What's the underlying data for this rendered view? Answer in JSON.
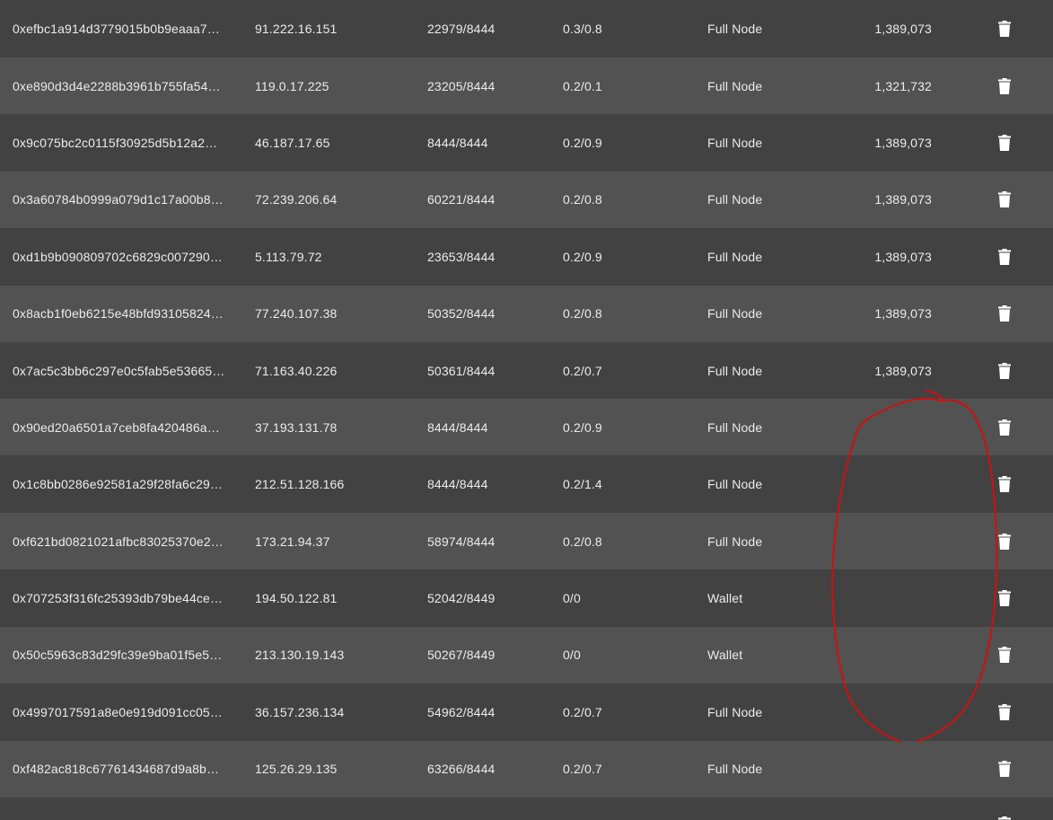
{
  "connections": {
    "rows": [
      {
        "node_id": "0xefbc1a914d3779015b0b9eaaa7…",
        "ip": "91.222.16.151",
        "ports": "22979/8444",
        "up_down": "0.3/0.8",
        "type": "Full Node",
        "height": "1,389,073"
      },
      {
        "node_id": "0xe890d3d4e2288b3961b755fa54…",
        "ip": "119.0.17.225",
        "ports": "23205/8444",
        "up_down": "0.2/0.1",
        "type": "Full Node",
        "height": "1,321,732"
      },
      {
        "node_id": "0x9c075bc2c0115f30925d5b12a2…",
        "ip": "46.187.17.65",
        "ports": "8444/8444",
        "up_down": "0.2/0.9",
        "type": "Full Node",
        "height": "1,389,073"
      },
      {
        "node_id": "0x3a60784b0999a079d1c17a00b8…",
        "ip": "72.239.206.64",
        "ports": "60221/8444",
        "up_down": "0.2/0.8",
        "type": "Full Node",
        "height": "1,389,073"
      },
      {
        "node_id": "0xd1b9b090809702c6829c007290…",
        "ip": "5.113.79.72",
        "ports": "23653/8444",
        "up_down": "0.2/0.9",
        "type": "Full Node",
        "height": "1,389,073"
      },
      {
        "node_id": "0x8acb1f0eb6215e48bfd93105824…",
        "ip": "77.240.107.38",
        "ports": "50352/8444",
        "up_down": "0.2/0.8",
        "type": "Full Node",
        "height": "1,389,073"
      },
      {
        "node_id": "0x7ac5c3bb6c297e0c5fab5e53665…",
        "ip": "71.163.40.226",
        "ports": "50361/8444",
        "up_down": "0.2/0.7",
        "type": "Full Node",
        "height": "1,389,073"
      },
      {
        "node_id": "0x90ed20a6501a7ceb8fa420486a…",
        "ip": "37.193.131.78",
        "ports": "8444/8444",
        "up_down": "0.2/0.9",
        "type": "Full Node",
        "height": ""
      },
      {
        "node_id": "0x1c8bb0286e92581a29f28fa6c29…",
        "ip": "212.51.128.166",
        "ports": "8444/8444",
        "up_down": "0.2/1.4",
        "type": "Full Node",
        "height": ""
      },
      {
        "node_id": "0xf621bd0821021afbc83025370e2…",
        "ip": "173.21.94.37",
        "ports": "58974/8444",
        "up_down": "0.2/0.8",
        "type": "Full Node",
        "height": ""
      },
      {
        "node_id": "0x707253f316fc25393db79be44ce…",
        "ip": "194.50.122.81",
        "ports": "52042/8449",
        "up_down": "0/0",
        "type": "Wallet",
        "height": ""
      },
      {
        "node_id": "0x50c5963c83d29fc39e9ba01f5e5…",
        "ip": "213.130.19.143",
        "ports": "50267/8449",
        "up_down": "0/0",
        "type": "Wallet",
        "height": ""
      },
      {
        "node_id": "0x4997017591a8e0e919d091cc05…",
        "ip": "36.157.236.134",
        "ports": "54962/8444",
        "up_down": "0.2/0.7",
        "type": "Full Node",
        "height": ""
      },
      {
        "node_id": "0xf482ac818c67761434687d9a8b…",
        "ip": "125.26.29.135",
        "ports": "63266/8444",
        "up_down": "0.2/0.7",
        "type": "Full Node",
        "height": ""
      }
    ],
    "delete_icon": "trash-icon"
  },
  "annotation": {
    "color": "#d01010"
  },
  "colors": {
    "row_dark": "#424242",
    "row_light": "#525252",
    "text": "#ececec"
  }
}
